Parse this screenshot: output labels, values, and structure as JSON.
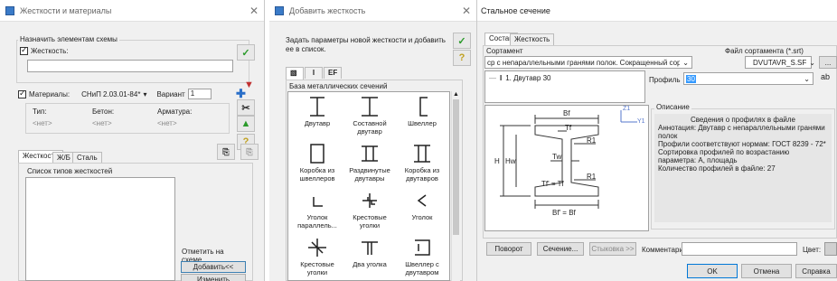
{
  "win1": {
    "title": "Жесткости и материалы",
    "assign_label": "Назначить элементам схемы",
    "stiffness_label": "Жесткость:",
    "material_label": "Материалы:",
    "material_value": "СНиП 2.03.01-84*",
    "variant_label": "Вариант",
    "variant_value": "1",
    "table_headers": [
      "Тип:",
      "Бетон:",
      "Арматура:"
    ],
    "table_values": [
      "<нет>",
      "<нет>",
      "<нет>"
    ],
    "tabs": [
      "Жесткости",
      "Ж/Б",
      "Сталь"
    ],
    "list_label": "Список типов жесткостей",
    "btn_mark": "Отметить на схеме",
    "btn_add": "Добавить<<",
    "btn_change": "Изменить"
  },
  "win2": {
    "title": "Добавить жесткость",
    "hint": "Задать параметры новой жесткости и добавить ее в список.",
    "tabs": [
      "▧",
      "I",
      "EF"
    ],
    "db_label": "База металлических сечений",
    "items": [
      {
        "label": "Двутавр",
        "icon": "i-beam-icon"
      },
      {
        "label": "Составной двутавр",
        "icon": "built-up-i-beam-icon"
      },
      {
        "label": "Швеллер",
        "icon": "channel-icon"
      },
      {
        "label": "Коробка из швеллеров",
        "icon": "box-channels-icon"
      },
      {
        "label": "Раздвинутые двутавры",
        "icon": "spread-i-beams-icon"
      },
      {
        "label": "Коробка из двутавров",
        "icon": "box-i-beams-icon"
      },
      {
        "label": "Уголок параллель...",
        "icon": "angle-parallel-icon"
      },
      {
        "label": "Крестовые уголки",
        "icon": "cross-angles-icon"
      },
      {
        "label": "Уголок",
        "icon": "angle-icon"
      },
      {
        "label": "Крестовые уголки",
        "icon": "cross-angles-2-icon"
      },
      {
        "label": "Два уголка",
        "icon": "two-angles-icon"
      },
      {
        "label": "Швеллер с двутавром",
        "icon": "channel-i-beam-icon"
      }
    ]
  },
  "win3": {
    "title": "Стальное сечение",
    "tabs": [
      "Состав",
      "Жесткость"
    ],
    "sortament_label": "Сортамент",
    "sortament_value": "ср с непараллельными гранями полок. Сокращенный сортамент",
    "file_label": "Файл сортамента (*.srt)",
    "file_value": "DVUTAVR_S.SF",
    "tree_item": "1. Двутавр 30",
    "profile_label": "Профиль",
    "profile_value": "30",
    "desc_title": "Описание",
    "desc_heading": "Сведения о профилях в файле",
    "desc_lines": [
      "Аннотация: Двутавр  с  непараллельными гранями полок",
      "Профили соответствуют нормам: ГОСТ 8239 - 72*",
      "Сортировка профилей по возрастанию параметра: А, площадь",
      "Количество профилей в файле: 27"
    ],
    "drawing_labels": {
      "bf": "Bf",
      "tf": "Tf",
      "r1": "R1",
      "h": "H",
      "hw": "Hw",
      "tw": "Tw",
      "tf_eq": "Tf' = Tf",
      "r1b": "R1",
      "bf_eq": "Bf' = Bf",
      "z1": "Z1",
      "y1": "Y1"
    },
    "btn_rotate": "Поворот",
    "btn_section": "Сечение...",
    "btn_dock": "Стыковка >>",
    "comment_label": "Комментарий:",
    "color_label": "Цвет:",
    "btn_ok": "OK",
    "btn_cancel": "Отмена",
    "btn_help": "Справка"
  }
}
